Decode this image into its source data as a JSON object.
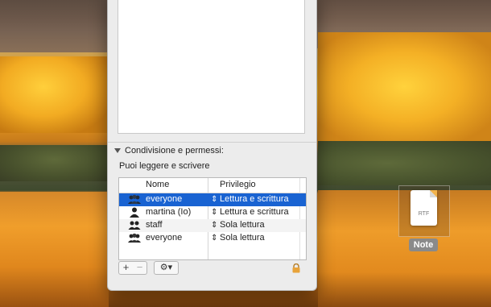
{
  "info_window": {
    "sharing_section": {
      "title": "Condivisione e permessi:",
      "status": "Puoi leggere e scrivere"
    },
    "permissions_table": {
      "headers": {
        "name": "Nome",
        "privilege": "Privilegio"
      },
      "rows": [
        {
          "icon": "group-icon",
          "name": "everyone",
          "privilege": "Lettura e scrittura",
          "selected": true
        },
        {
          "icon": "user-icon",
          "name": "martina (Io)",
          "privilege": "Lettura e scrittura",
          "selected": false
        },
        {
          "icon": "group-icon",
          "name": "staff",
          "privilege": "Sola lettura",
          "selected": false
        },
        {
          "icon": "group-icon",
          "name": "everyone",
          "privilege": "Sola lettura",
          "selected": false
        }
      ]
    },
    "toolbar": {
      "add_label": "+",
      "remove_label": "−",
      "action_label": "⚙▾",
      "lock_icon": "lock-icon"
    }
  },
  "desktop_file": {
    "extension": "RTF",
    "name": "Note"
  },
  "colors": {
    "selection": "#1963d2",
    "window_bg": "#ececec",
    "lock": "#e8a33a"
  }
}
